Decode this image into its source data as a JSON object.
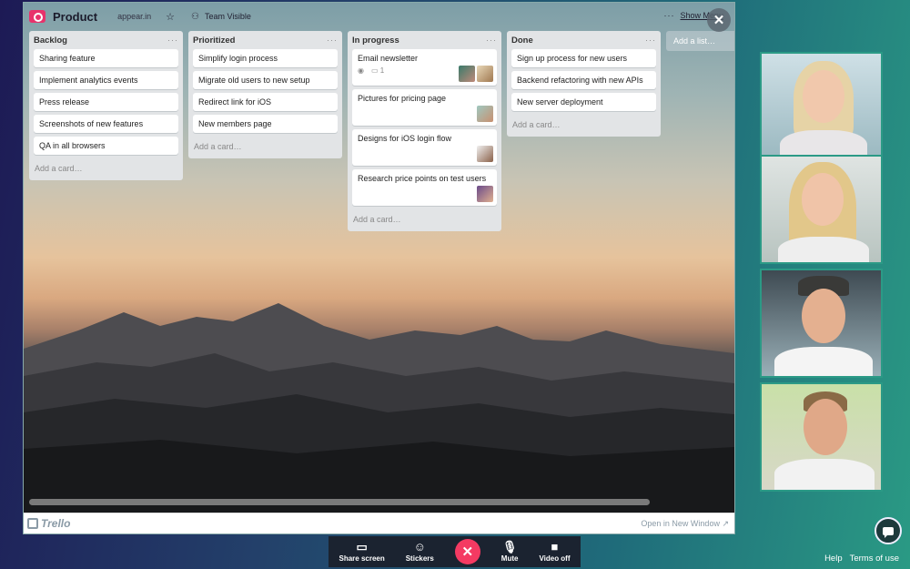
{
  "board": {
    "title": "Product",
    "org": "appear.in",
    "visibility": "Team Visible",
    "show_menu": "Show Menu",
    "add_list": "Add a list…",
    "add_card": "Add a card…",
    "lists": [
      {
        "name": "Backlog",
        "cards": [
          {
            "text": "Sharing feature"
          },
          {
            "text": "Implement analytics events"
          },
          {
            "text": "Press release"
          },
          {
            "text": "Screenshots of new features"
          },
          {
            "text": "QA in all browsers"
          }
        ]
      },
      {
        "name": "Prioritized",
        "cards": [
          {
            "text": "Simplify login process"
          },
          {
            "text": "Migrate old users to new setup"
          },
          {
            "text": "Redirect link for iOS"
          },
          {
            "text": "New members page"
          }
        ]
      },
      {
        "name": "In progress",
        "cards": [
          {
            "text": "Email newsletter",
            "comments": "1"
          },
          {
            "text": "Pictures for pricing page"
          },
          {
            "text": "Designs for iOS login flow"
          },
          {
            "text": "Research price points on test users"
          }
        ]
      },
      {
        "name": "Done",
        "cards": [
          {
            "text": "Sign up process for new users"
          },
          {
            "text": "Backend refactoring with new APIs"
          },
          {
            "text": "New server deployment"
          }
        ]
      }
    ]
  },
  "embed_footer": {
    "logo": "Trello",
    "open_new_window": "Open in New Window ↗"
  },
  "controls": {
    "share_screen": "Share screen",
    "stickers": "Stickers",
    "mute": "Mute",
    "video_off": "Video off"
  },
  "footer": {
    "help": "Help",
    "terms": "Terms of use"
  },
  "colors": {
    "accent": "#f43a62",
    "tile_border": "#2b9a86",
    "brand": "#e8326b"
  }
}
